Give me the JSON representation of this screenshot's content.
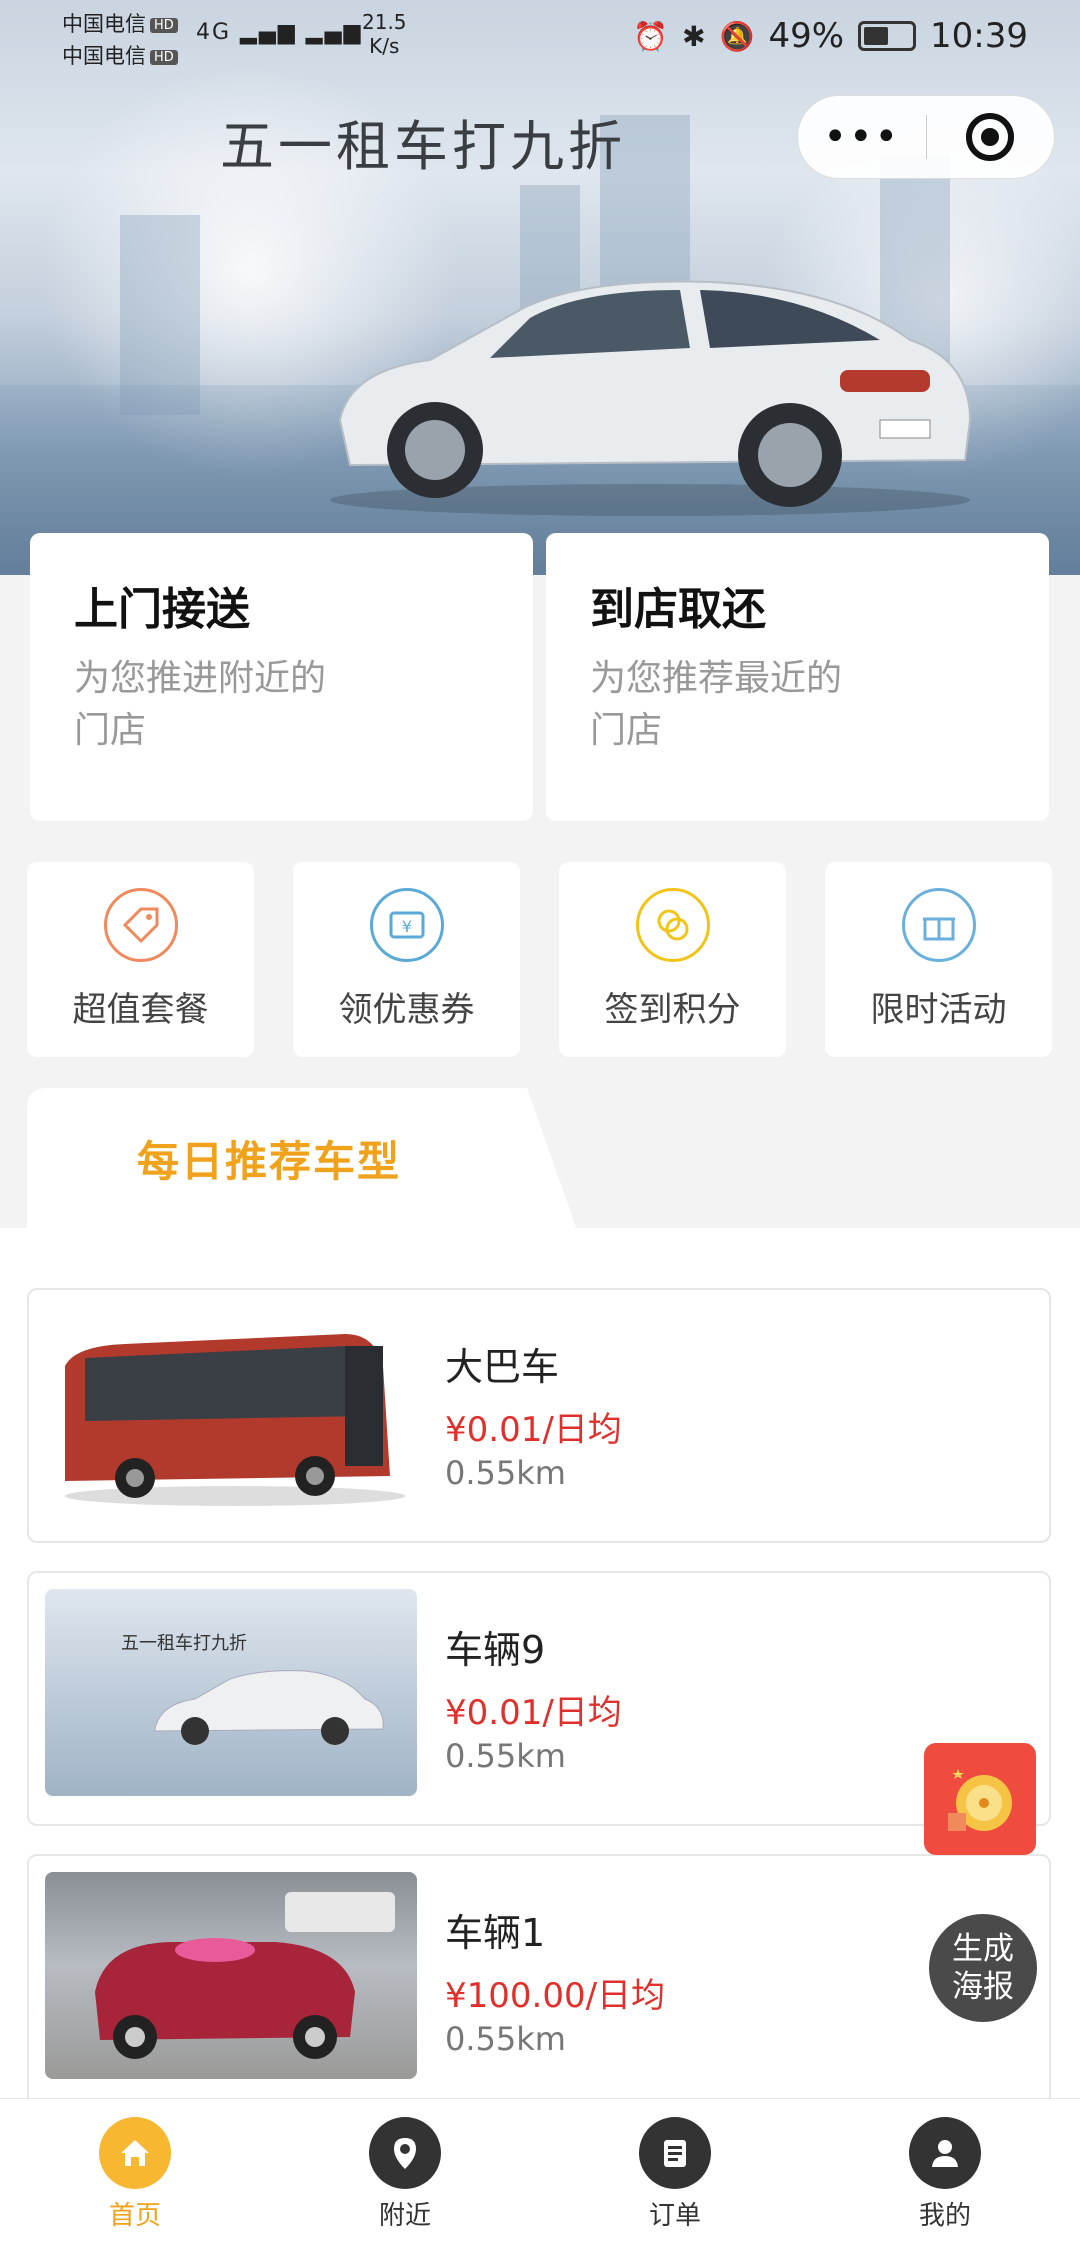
{
  "status_bar": {
    "carrier1": "中国电信",
    "carrier2": "中国电信",
    "hd": "HD",
    "network": "4G",
    "speed_value": "21.5",
    "speed_unit": "K/s",
    "battery": "49%",
    "time": "10:39"
  },
  "hero": {
    "title": "五一租车打九折"
  },
  "capsule": {
    "more_label": "•••"
  },
  "services": [
    {
      "title": "上门接送",
      "subtitle": "为您推进附近的门店"
    },
    {
      "title": "到店取还",
      "subtitle": "为您推荐最近的门店"
    }
  ],
  "features": [
    {
      "label": "超值套餐",
      "icon": "tag-icon",
      "color": "#f08a5d"
    },
    {
      "label": "领优惠券",
      "icon": "coupon-icon",
      "color": "#5aa9d6"
    },
    {
      "label": "签到积分",
      "icon": "coins-icon",
      "color": "#f2c418"
    },
    {
      "label": "限时活动",
      "icon": "gift-icon",
      "color": "#6bb0dc"
    }
  ],
  "recommend": {
    "tab_label": "每日推荐车型"
  },
  "cars": [
    {
      "name": "大巴车",
      "price": "¥0.01/日均",
      "distance": "0.55km"
    },
    {
      "name": "车辆9",
      "price": "¥0.01/日均",
      "distance": "0.55km",
      "image_caption": "五一租车打九折"
    },
    {
      "name": "车辆1",
      "price": "¥100.00/日均",
      "distance": "0.55km"
    }
  ],
  "floating": {
    "poster_line1": "生成",
    "poster_line2": "海报"
  },
  "tabbar": [
    {
      "label": "首页",
      "icon": "home-icon",
      "active": true
    },
    {
      "label": "附近",
      "icon": "location-pin-icon",
      "active": false
    },
    {
      "label": "订单",
      "icon": "order-list-icon",
      "active": false
    },
    {
      "label": "我的",
      "icon": "user-icon",
      "active": false
    }
  ],
  "colors": {
    "accent": "#f7b731",
    "price": "#e0302c",
    "recommend": "#f0a21d"
  }
}
